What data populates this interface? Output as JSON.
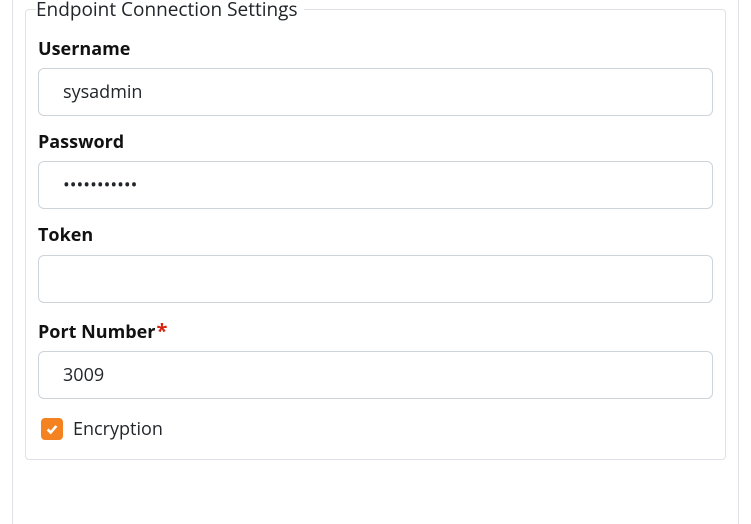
{
  "settings": {
    "legend": "Endpoint Connection Settings",
    "fields": {
      "username": {
        "label": "Username",
        "value": "sysadmin"
      },
      "password": {
        "label": "Password",
        "value": "•••••••••••"
      },
      "token": {
        "label": "Token",
        "value": ""
      },
      "port": {
        "label": "Port Number",
        "value": "3009",
        "required": true
      },
      "encryption": {
        "label": "Encryption",
        "checked": true
      }
    }
  }
}
